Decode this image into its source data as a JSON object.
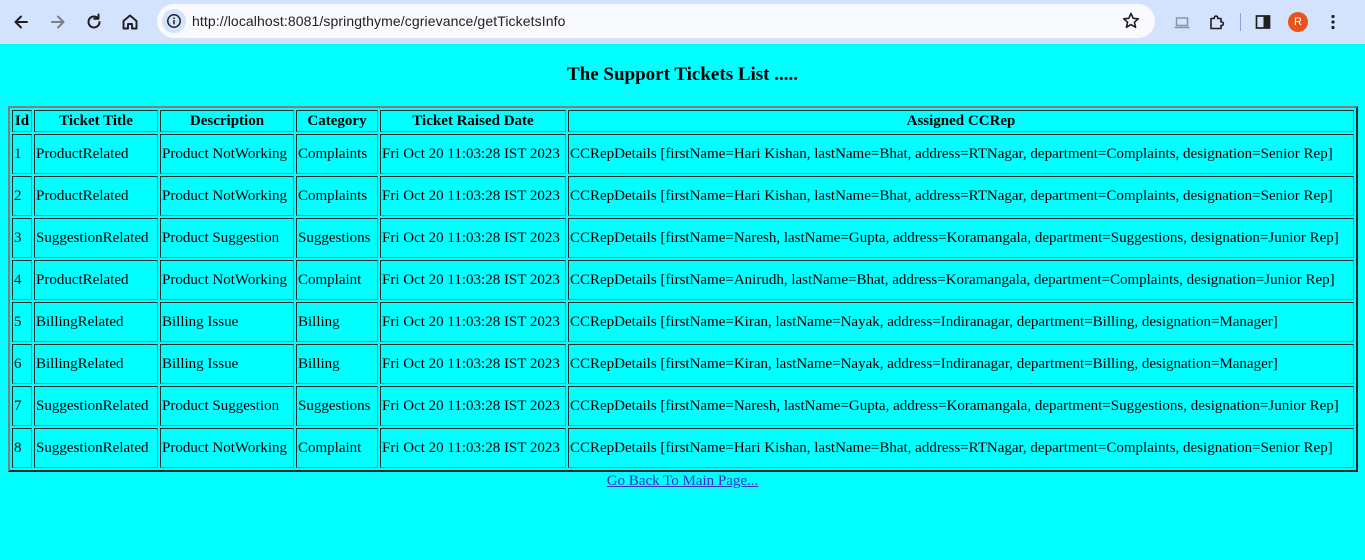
{
  "browser": {
    "url": "http://localhost:8081/springthyme/cgrievance/getTicketsInfo",
    "profile_initial": "R"
  },
  "page": {
    "title": "The Support Tickets List .....",
    "back_link": "Go Back To Main Page..."
  },
  "table": {
    "headers": [
      "Id",
      "Ticket Title",
      "Description",
      "Category",
      "Ticket Raised Date",
      "Assigned CCRep"
    ],
    "rows": [
      [
        "1",
        "ProductRelated",
        "Product NotWorking",
        "Complaints",
        "Fri Oct 20 11:03:28 IST 2023",
        "CCRepDetails [firstName=Hari Kishan, lastName=Bhat, address=RTNagar, department=Complaints, designation=Senior Rep]"
      ],
      [
        "2",
        "ProductRelated",
        "Product NotWorking",
        "Complaints",
        "Fri Oct 20 11:03:28 IST 2023",
        "CCRepDetails [firstName=Hari Kishan, lastName=Bhat, address=RTNagar, department=Complaints, designation=Senior Rep]"
      ],
      [
        "3",
        "SuggestionRelated",
        "Product Suggestion",
        "Suggestions",
        "Fri Oct 20 11:03:28 IST 2023",
        "CCRepDetails [firstName=Naresh, lastName=Gupta, address=Koramangala, department=Suggestions, designation=Junior Rep]"
      ],
      [
        "4",
        "ProductRelated",
        "Product NotWorking",
        "Complaint",
        "Fri Oct 20 11:03:28 IST 2023",
        "CCRepDetails [firstName=Anirudh, lastName=Bhat, address=Koramangala, department=Complaints, designation=Junior Rep]"
      ],
      [
        "5",
        "BillingRelated",
        "Billing Issue",
        "Billing",
        "Fri Oct 20 11:03:28 IST 2023",
        "CCRepDetails [firstName=Kiran, lastName=Nayak, address=Indiranagar, department=Billing, designation=Manager]"
      ],
      [
        "6",
        "BillingRelated",
        "Billing Issue",
        "Billing",
        "Fri Oct 20 11:03:28 IST 2023",
        "CCRepDetails [firstName=Kiran, lastName=Nayak, address=Indiranagar, department=Billing, designation=Manager]"
      ],
      [
        "7",
        "SuggestionRelated",
        "Product Suggestion",
        "Suggestions",
        "Fri Oct 20 11:03:28 IST 2023",
        "CCRepDetails [firstName=Naresh, lastName=Gupta, address=Koramangala, department=Suggestions, designation=Junior Rep]"
      ],
      [
        "8",
        "SuggestionRelated",
        "Product NotWorking",
        "Complaint",
        "Fri Oct 20 11:03:28 IST 2023",
        "CCRepDetails [firstName=Hari Kishan, lastName=Bhat, address=RTNagar, department=Complaints, designation=Senior Rep]"
      ]
    ]
  },
  "colors": {
    "page_background": "#00ffff",
    "chrome_background": "#d3e3fd",
    "link": "#3b2fc9"
  },
  "icons": {
    "back": "arrow-left-icon",
    "forward": "arrow-right-icon",
    "reload": "reload-icon",
    "home": "home-icon",
    "site_info": "info-icon",
    "bookmark": "star-icon",
    "cast": "laptop-icon",
    "extensions": "puzzle-icon",
    "side_panel": "side-panel-icon",
    "menu": "kebab-menu-icon"
  }
}
